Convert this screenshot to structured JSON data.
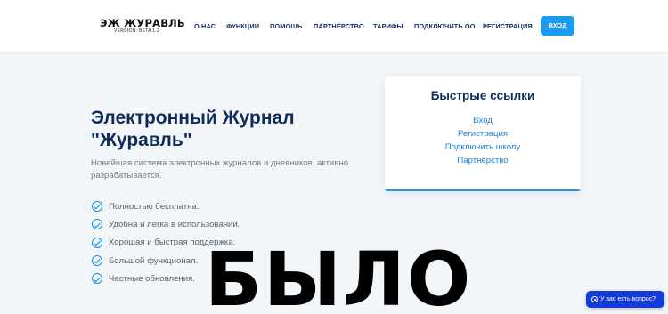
{
  "header": {
    "logo_title": "ЭЖ ЖУРАВЛЬ",
    "logo_subtitle": "VERSION: BETA 1.2",
    "nav": [
      {
        "label": "О НАС"
      },
      {
        "label": "ФУНКЦИИ"
      },
      {
        "label": "ПОМОЩЬ"
      },
      {
        "label": "ПАРТНЁРСТВО"
      },
      {
        "label": "ТАРИФЫ"
      },
      {
        "label": "ПОДКЛЮЧИТЬ ОО"
      },
      {
        "label": "РЕГИСТРАЦИЯ"
      }
    ],
    "login_label": "ВХОД"
  },
  "hero": {
    "title_line1": "Электронный Журнал",
    "title_line2": "\"Журавль\"",
    "description": "Новейшая система электронных журналов и дневников, активно разрабатывается.",
    "features": [
      "Полностью бесплатна.",
      "Удобна и легка в использовании.",
      "Хорошая и быстрая поддержка.",
      "Большой функционал.",
      "Частные обновления."
    ]
  },
  "quick_links": {
    "title": "Быстрые ссылки",
    "links": [
      "Вход",
      "Регистрация",
      "Подключить школу",
      "Партнёрство"
    ]
  },
  "overlay_text": "БЫЛО",
  "chat": {
    "label": "У вас есть вопрос?",
    "icon": "chat-icon"
  },
  "colors": {
    "navy": "#0f2c59",
    "accent": "#1a9bef",
    "chat_blue": "#123bd8",
    "page_bg": "#f3f6f9"
  }
}
